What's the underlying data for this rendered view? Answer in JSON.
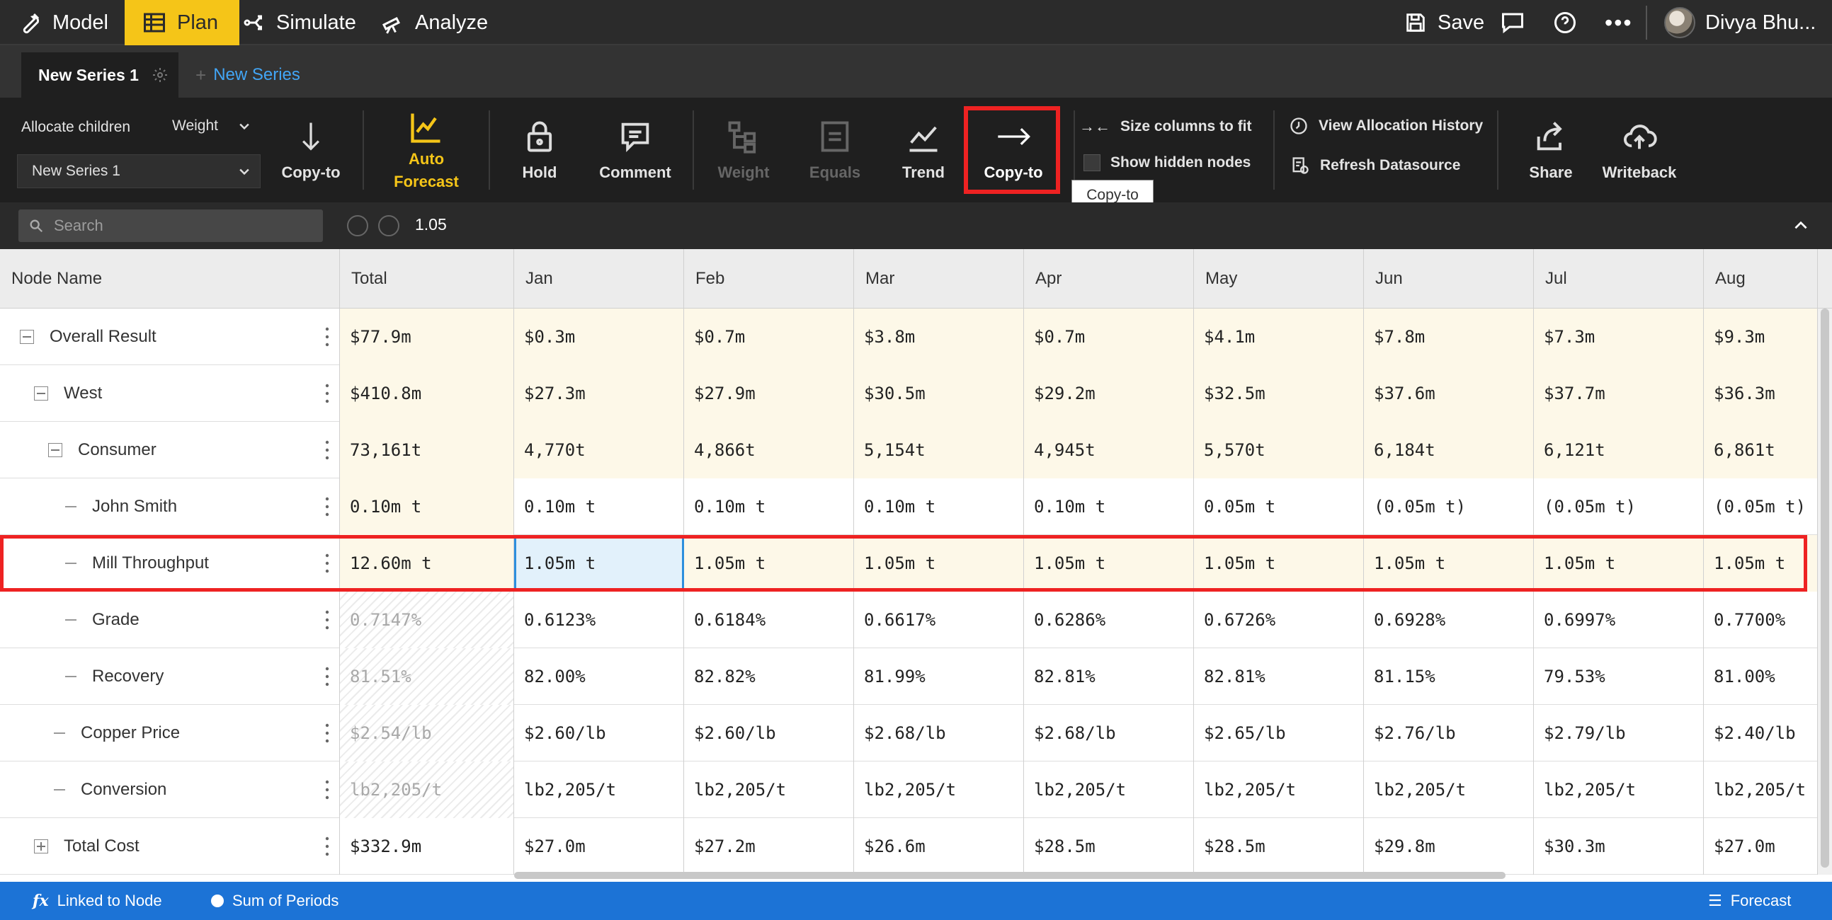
{
  "nav": {
    "items": [
      {
        "label": "Model",
        "icon": "wrench-icon"
      },
      {
        "label": "Plan",
        "icon": "table-icon",
        "active": true
      },
      {
        "label": "Simulate",
        "icon": "simulate-icon"
      },
      {
        "label": "Analyze",
        "icon": "telescope-icon"
      }
    ],
    "save_label": "Save",
    "user_name": "Divya Bhu..."
  },
  "tabs": {
    "active_series": "New Series 1",
    "new_series_label": "New Series"
  },
  "ribbon": {
    "allocate_label": "Allocate children",
    "allocate_method": "Weight",
    "series_select": "New Series 1",
    "copy_to_small": "Copy-to",
    "auto_forecast_line1": "Auto",
    "auto_forecast_line2": "Forecast",
    "hold": "Hold",
    "comment": "Comment",
    "weight": "Weight",
    "equals": "Equals",
    "trend": "Trend",
    "copy_to": "Copy-to",
    "size_columns": "Size columns to fit",
    "show_hidden": "Show hidden nodes",
    "view_history": "View Allocation History",
    "refresh": "Refresh Datasource",
    "share": "Share",
    "writeback": "Writeback",
    "tooltip": "Copy-to"
  },
  "search": {
    "placeholder": "Search",
    "formula_value": "1.05"
  },
  "grid": {
    "columns": [
      "Node Name",
      "Total",
      "Jan",
      "Feb",
      "Mar",
      "Apr",
      "May",
      "Jun",
      "Jul",
      "Aug"
    ],
    "rows": [
      {
        "name": "Overall Result",
        "values": [
          "$77.9m",
          "$0.3m",
          "$0.7m",
          "$3.8m",
          "$0.7m",
          "$4.1m",
          "$7.8m",
          "$7.3m",
          "$9.3m"
        ]
      },
      {
        "name": "West",
        "values": [
          "$410.8m",
          "$27.3m",
          "$27.9m",
          "$30.5m",
          "$29.2m",
          "$32.5m",
          "$37.6m",
          "$37.7m",
          "$36.3m"
        ]
      },
      {
        "name": "Consumer",
        "values": [
          "73,161t",
          "4,770t",
          "4,866t",
          "5,154t",
          "4,945t",
          "5,570t",
          "6,184t",
          "6,121t",
          "6,861t"
        ]
      },
      {
        "name": "John Smith",
        "values": [
          "0.10m t",
          "0.10m t",
          "0.10m t",
          "0.10m t",
          "0.10m t",
          "0.05m t",
          "(0.05m t)",
          "(0.05m t)",
          "(0.05m t)"
        ]
      },
      {
        "name": "Mill Throughput",
        "values": [
          "12.60m t",
          "1.05m t",
          "1.05m t",
          "1.05m t",
          "1.05m t",
          "1.05m t",
          "1.05m t",
          "1.05m t",
          "1.05m t"
        ]
      },
      {
        "name": "Grade",
        "values": [
          "0.7147%",
          "0.6123%",
          "0.6184%",
          "0.6617%",
          "0.6286%",
          "0.6726%",
          "0.6928%",
          "0.6997%",
          "0.7700%"
        ]
      },
      {
        "name": "Recovery",
        "values": [
          "81.51%",
          "82.00%",
          "82.82%",
          "81.99%",
          "82.81%",
          "82.81%",
          "81.15%",
          "79.53%",
          "81.00%"
        ]
      },
      {
        "name": "Copper Price",
        "values": [
          "$2.54/lb",
          "$2.60/lb",
          "$2.60/lb",
          "$2.68/lb",
          "$2.68/lb",
          "$2.65/lb",
          "$2.76/lb",
          "$2.79/lb",
          "$2.40/lb"
        ]
      },
      {
        "name": "Conversion",
        "values": [
          "lb2,205/t",
          "lb2,205/t",
          "lb2,205/t",
          "lb2,205/t",
          "lb2,205/t",
          "lb2,205/t",
          "lb2,205/t",
          "lb2,205/t",
          "lb2,205/t"
        ]
      },
      {
        "name": "Total Cost",
        "values": [
          "$332.9m",
          "$27.0m",
          "$27.2m",
          "$26.6m",
          "$28.5m",
          "$28.5m",
          "$29.8m",
          "$30.3m",
          "$27.0m"
        ]
      }
    ]
  },
  "status": {
    "linked": "Linked to Node",
    "sum": "Sum of Periods",
    "forecast": "Forecast"
  },
  "colors": {
    "nav_active": "#f5c518",
    "highlight_border": "#ee2222",
    "status_bar": "#1c73d6",
    "link_blue": "#42a5f5"
  }
}
